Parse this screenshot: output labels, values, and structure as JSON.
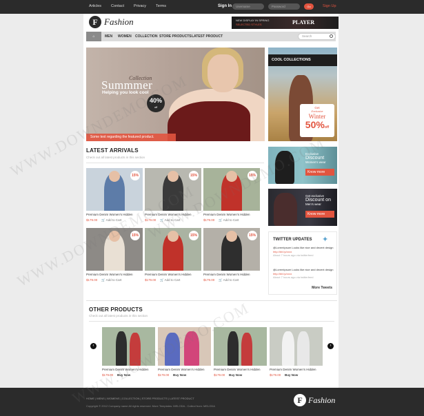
{
  "topbar": {
    "links": [
      "Articles",
      "Contact",
      "Privacy",
      "Terms"
    ],
    "signin": "Sign In",
    "username_placeholder": "Username",
    "password_placeholder": "Password",
    "go": "Go",
    "signup": "Sign Up"
  },
  "header": {
    "logo_letter": "F",
    "logo_text": "Fashion",
    "ad_line1": "NEW DISPLAY IN SPRING",
    "ad_line2": "SELECTED STYLES",
    "ad_brand": "PLAYER"
  },
  "nav": {
    "home": "",
    "items": [
      "MEN",
      "WOMEN",
      "COLLECTION",
      "STORE PRODUCTS",
      "LATEST PRODUCT"
    ],
    "search_placeholder": "Search"
  },
  "hero": {
    "collection": "Collection",
    "title": "Summmer",
    "tagline": "Helping you look cool",
    "badge_value": "40%",
    "badge_small": "off",
    "caption": "Some text regarding the featured product."
  },
  "cool": {
    "title": "COOL COLLECTIONS",
    "line1": "Get",
    "line2": "Exclusive",
    "line3": "Winter",
    "line4": "50%",
    "line4b": "off"
  },
  "latest": {
    "title": "LATEST ARRIVALS",
    "subtitle": "Check out all latest products in this section",
    "products": [
      {
        "name": "Premium Denim Women's Hidden",
        "price": "$179.00",
        "cart": "Add to Cart",
        "sale": "15%"
      },
      {
        "name": "Premium Denim Women's Hidden",
        "price": "$179.00",
        "cart": "Add to Cart",
        "sale": "15%"
      },
      {
        "name": "Premium Denim Women's Hidden",
        "price": "$179.00",
        "cart": "Add to Cart",
        "sale": "15%"
      },
      {
        "name": "Premium Denim Women's Hidden",
        "price": "$179.00",
        "cart": "Add to Cart",
        "sale": "15%"
      },
      {
        "name": "Premium Denim Women's Hidden",
        "price": "$179.00",
        "cart": "Add to Cart",
        "sale": "15%"
      },
      {
        "name": "Premium Denim Women's Hidden",
        "price": "$179.00",
        "cart": "Add to Cart",
        "sale": "15%"
      }
    ]
  },
  "side_promos": [
    {
      "small": "Exclusive",
      "big": "Discount",
      "tail": "Women's wear",
      "more": "Know more"
    },
    {
      "small": "Get exclusive",
      "big": "Discount on",
      "tail": "Men's wear",
      "more": "Know more"
    }
  ],
  "twitter": {
    "title": "TWITTER UPDATES",
    "tweets": [
      {
        "text": "@LoremIpsum Looks like nice and decent design",
        "link": "http://bit.ly/xxxx",
        "time": "About 7 hours ago via twitterfeed"
      },
      {
        "text": "@LoremIpsum Looks like nice and decent design",
        "link": "http://bit.ly/xxxx",
        "time": "About 7 hours ago via twitterfeed"
      }
    ],
    "more": "More Tweets"
  },
  "other": {
    "title": "OTHER PRODUCTS",
    "subtitle": "Check out all latest products in this section",
    "products": [
      {
        "name": "Premium Denim Women's Hidden",
        "price": "$179.00",
        "buy": "Buy Now"
      },
      {
        "name": "Premium Denim Women's Hidden",
        "price": "$179.00",
        "buy": "Buy Now"
      },
      {
        "name": "Premium Denim Women's Hidden",
        "price": "$179.00",
        "buy": "Buy Now"
      },
      {
        "name": "Premium Denim Women's Hidden",
        "price": "$179.00",
        "buy": "Buy Now"
      }
    ]
  },
  "footer": {
    "links": "HOME | MENS | WOMENS | COLLECTION | STORE PRODUCTS | LATEST PRODUCT",
    "copyright": "Copyright © 2012 Company name All rights reserved. More Templates: MELODA - Collect from: MELODA",
    "logo_letter": "F",
    "logo_text": "Fashion"
  },
  "watermark": "WWW.DOWNDEMO.COM",
  "colors": {
    "accent": "#e2543f",
    "dark": "#2b2b2b",
    "page_bg": "#ececec"
  }
}
